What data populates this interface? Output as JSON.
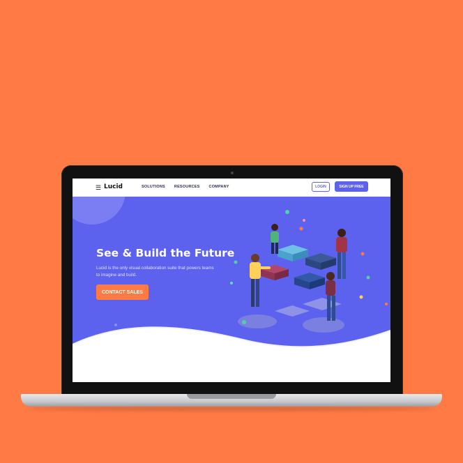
{
  "nav": {
    "menu_icon": "hamburger-icon",
    "logo": "Lucid",
    "links": [
      "SOLUTIONS",
      "RESOURCES",
      "COMPANY"
    ],
    "login": "LOGIN",
    "signup": "SIGN UP FREE"
  },
  "hero": {
    "title": "See & Build the Future",
    "subtitle": "Lucid is the only visual collaboration suite that powers teams to imagine and build.",
    "cta": "CONTACT SALES"
  },
  "colors": {
    "background": "#FF7A45",
    "brand": "#5C62EE",
    "accent": "#FF7A45"
  }
}
